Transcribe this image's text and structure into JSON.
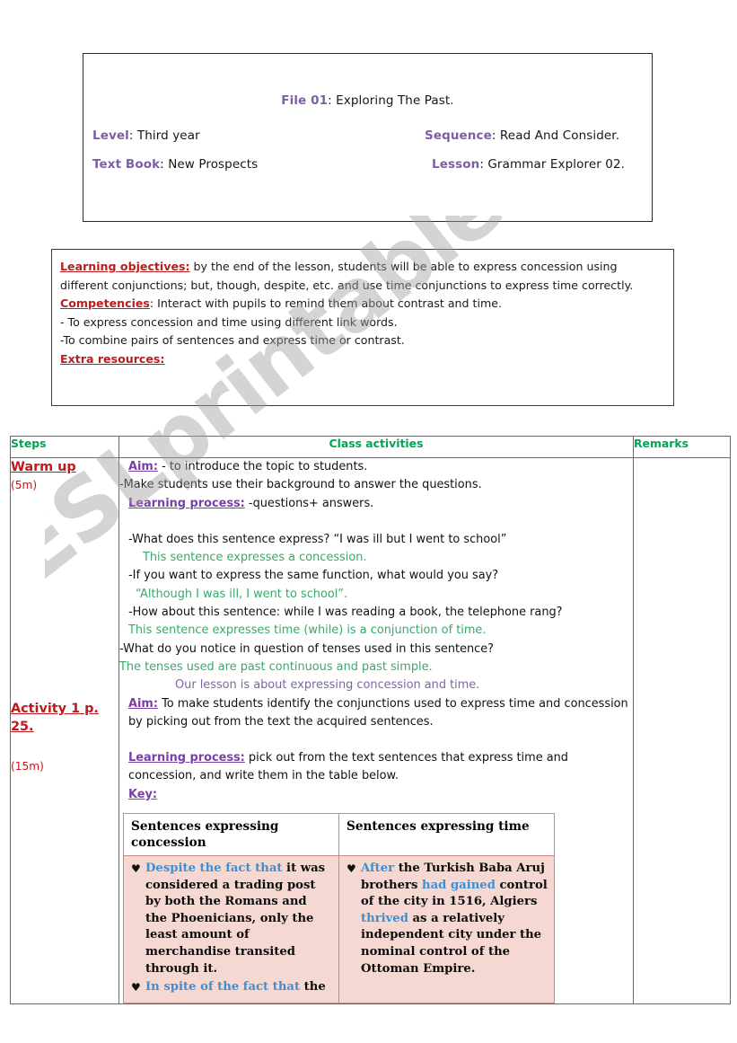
{
  "watermark": {
    "text": "ESLprintables.com"
  },
  "header": {
    "file_label": "File 01",
    "file_value": ": Exploring The Past.",
    "level_label": "Level",
    "level_value": ": Third year",
    "sequence_label": "Sequence",
    "sequence_value": ": Read And Consider.",
    "textbook_label": "Text Book",
    "textbook_value": ": New Prospects",
    "lesson_label": "Lesson",
    "lesson_value": ": Grammar Explorer 02."
  },
  "objectives": {
    "learning_objectives_label": "Learning objectives:",
    "learning_objectives_text": " by the end of the lesson, students will be able to express concession using different conjunctions; but, though, despite, etc. and use time conjunctions to express time correctly.",
    "competencies_label": "Competencies",
    "competencies_text": ": Interact with pupils to remind them about contrast and time.",
    "bullet_1": "- To express concession and time using different link words.",
    "bullet_2": "-To combine pairs of sentences and express time or contrast.",
    "extra_resources_label": "Extra resources:"
  },
  "table": {
    "headers": {
      "steps": "Steps",
      "class_activities": "Class activities",
      "remarks": "Remarks"
    },
    "rows": [
      {
        "step_title": "Warm up",
        "step_time": "(5m)",
        "aim_label": "Aim:",
        "aim_text": " - to introduce the topic to students.",
        "make_line": "-Make students use their background to answer the questions.",
        "process_label": "Learning process:",
        "process_text": " -questions+ answers.",
        "qa": [
          {
            "q": "-What does this sentence express? “I was ill but I went to school”",
            "a": "This sentence expresses a concession."
          },
          {
            "q": "-If you want to express the same function, what would you say?",
            "a": "“Although I was ill, I went to school”."
          },
          {
            "q": "-How about this sentence: while I was reading a book, the telephone rang?",
            "a": "This sentence expresses time (while) is a conjunction of time."
          },
          {
            "q": "-What do you notice in question of tenses used in this sentence?",
            "a": "The tenses used are past continuous and past simple."
          }
        ],
        "closing": "Our lesson is about expressing concession and time."
      },
      {
        "step_title": "Activity 1 p. 25.",
        "step_time": "(15m)",
        "aim_label": "Aim:",
        "aim_text": " To make students identify the conjunctions used to express time and concession by picking out from the text the acquired sentences.",
        "process_label": "Learning process:",
        "process_text": " pick out from the text sentences that express time and concession, and write them in the table below.",
        "key_label": "Key:",
        "key_table": {
          "col1_header": "Sentences expressing concession",
          "col2_header": "Sentences expressing time",
          "col1_items": [
            {
              "bullet": "♥",
              "kw": "Despite the fact that",
              "rest": " it was considered a trading post by both the Romans and the Phoenicians, only the least amount of merchandise transited through it."
            },
            {
              "bullet": "♥",
              "kw": "In spite of the fact that",
              "rest": " the"
            }
          ],
          "col2_items": [
            {
              "bullet": "♥",
              "kw": "After",
              "rest": " the Turkish Baba Aruj brothers ",
              "kw2": "had gained",
              "rest2": " control of the city in 1516, Algiers ",
              "kw3": "thrived",
              "rest3": " as a relatively independent city under the nominal control of the Ottoman Empire."
            }
          ]
        }
      }
    ]
  },
  "colors": {
    "purple": "#7d5fa5",
    "red": "#c0191b",
    "green": "#00a550",
    "green_answer": "#3aa86b",
    "blue_keyword": "#3d8fd1",
    "pink_cell": "#f6d8d3",
    "pink_border": "#c98a86"
  }
}
